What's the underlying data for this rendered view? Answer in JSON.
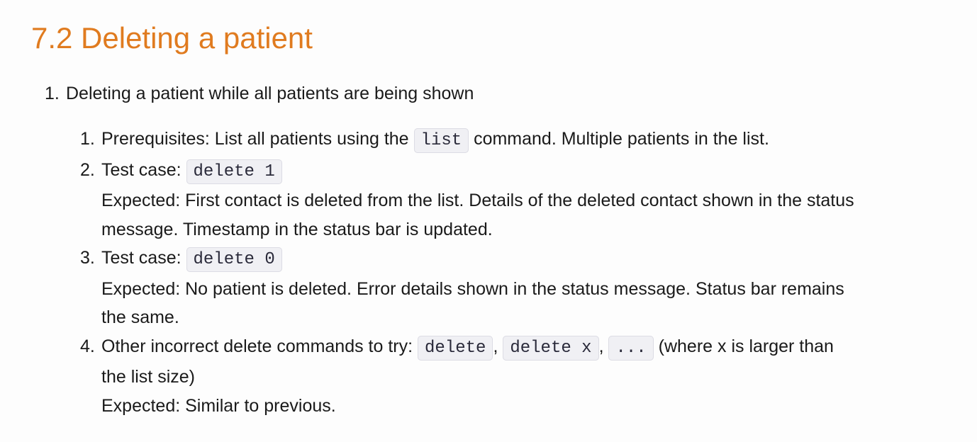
{
  "heading": "7.2 Deleting a patient",
  "outer_list": [
    {
      "number": "1.",
      "text": "Deleting a patient while all patients are being shown"
    }
  ],
  "steps": [
    {
      "number": "1.",
      "before_code": "Prerequisites: List all patients using the ",
      "code": "list",
      "after_code": " command. Multiple patients in the list."
    },
    {
      "number": "2.",
      "label": "Test case: ",
      "code": "delete 1",
      "expected_line1": "Expected: First contact is deleted from the list. Details of the deleted contact shown in the status",
      "expected_line2": "message. Timestamp in the status bar is updated."
    },
    {
      "number": "3.",
      "label": "Test case: ",
      "code": "delete 0",
      "expected_line1": "Expected: No patient is deleted. Error details shown in the status message. Status bar remains",
      "expected_line2": "the same."
    },
    {
      "number": "4.",
      "label": "Other incorrect delete commands to try: ",
      "code1": "delete",
      "sep1": ", ",
      "code2": "delete x",
      "sep2": ", ",
      "code3": "...",
      "after_codes": " (where x is larger than",
      "line2": "the list size)",
      "expected": "Expected: Similar to previous."
    }
  ],
  "colors": {
    "heading": "#e07b1f",
    "text": "#1a1a1a",
    "code_background": "#f0f0f4"
  }
}
